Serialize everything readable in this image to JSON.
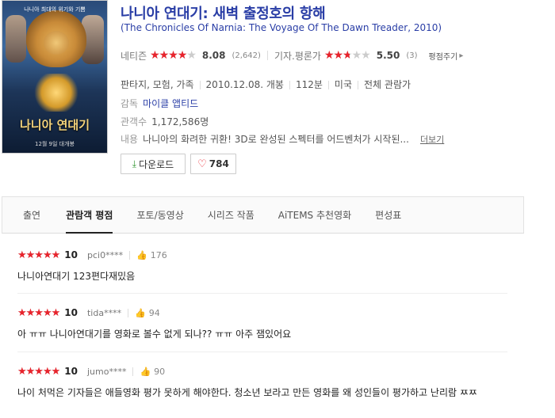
{
  "poster": {
    "tagline": "나니아 최대의 위기와 기쁨",
    "title": "나니아 연대기",
    "release_line": "12월 9일 대개봉"
  },
  "movie": {
    "title": "나니아 연대기: 새벽 출정호의 항해",
    "original_title": "(The Chronicles Of Narnia: The Voyage Of The Dawn Treader, 2010)"
  },
  "ratings": {
    "netizen_label": "네티즌",
    "netizen_score": "8.08",
    "netizen_fill": 0.808,
    "netizen_count": "(2,642)",
    "critic_label": "기자.평론가",
    "critic_score": "5.50",
    "critic_fill": 0.55,
    "critic_count": "(3)",
    "write_label": "평점주기"
  },
  "meta": {
    "genre": "판타지, 모험, 가족",
    "release": "2010.12.08. 개봉",
    "runtime": "112분",
    "country": "미국",
    "grade": "전체 관람가",
    "director_label": "감독",
    "director": "마이클 앱티드",
    "audience_label": "관객수",
    "audience": "1,172,586명",
    "summary_label": "내용",
    "summary": "나니아의 화려한 귀환! 3D로 완성된 스펙터를 어드벤처가 시작된...",
    "more_label": "더보기"
  },
  "buttons": {
    "download": "다운로드",
    "like_count": "784"
  },
  "tabs": [
    {
      "label": "출연"
    },
    {
      "label": "관람객 평점"
    },
    {
      "label": "포토/동영상"
    },
    {
      "label": "시리즈 작품"
    },
    {
      "label": "AiTEMS 추천영화"
    },
    {
      "label": "편성표"
    }
  ],
  "reviews": [
    {
      "score": "10",
      "fill": 1.0,
      "user": "pci0****",
      "likes": "176",
      "text": "나니아연대기 123편다재밌음"
    },
    {
      "score": "10",
      "fill": 1.0,
      "user": "tida****",
      "likes": "94",
      "text": "아 ㅠㅠ 나니아연대기를 영화로 볼수 없게 되나?? ㅠㅠ 아주 잼있어요"
    },
    {
      "score": "10",
      "fill": 1.0,
      "user": "jumo****",
      "likes": "90",
      "text": "나이 처먹은 기자들은 애들영화 평가 못하게 해야한다. 청소년 보라고 만든 영화를 왜 성인들이 평가하고 난리람 ㅉㅉ"
    }
  ],
  "colors": {
    "title_blue": "#2a3ea6",
    "star_red": "#e8232c",
    "download_green": "#3a9a3a"
  }
}
